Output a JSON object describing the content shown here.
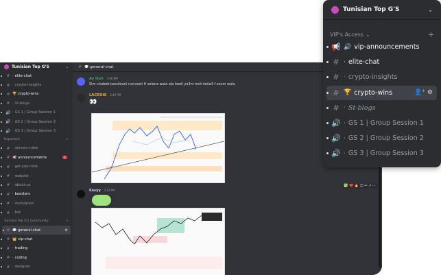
{
  "server": {
    "name": "Tunisian Top G'S"
  },
  "sidebar": {
    "channels_top": [
      {
        "icon": "#",
        "emoji": "·",
        "label": "elite-chat",
        "bright": true
      },
      {
        "icon": "#",
        "emoji": "·",
        "label": "crypto-insights"
      },
      {
        "icon": "#",
        "emoji": "🏆",
        "label": "crypto-wins",
        "bright": true
      },
      {
        "icon": "#",
        "emoji": "·",
        "label": "St-blogs",
        "italic": true
      },
      {
        "icon": "🔊",
        "emoji": "·",
        "label": "GS 1 | Group Session 1"
      },
      {
        "icon": "🔊",
        "emoji": "·",
        "label": "GS 2 | Group Session 2"
      },
      {
        "icon": "🔊",
        "emoji": "·",
        "label": "GS 3 | Group Session 3"
      }
    ],
    "category_important": "Important",
    "channels_important": [
      {
        "icon": "#",
        "emoji": "·",
        "label": "servers-rules"
      },
      {
        "icon": "#",
        "emoji": "📢",
        "label": "announcements",
        "bright": true,
        "badge": "1"
      },
      {
        "icon": "#",
        "emoji": "·",
        "label": "get-your-role"
      },
      {
        "icon": "#",
        "emoji": "·",
        "label": "website"
      },
      {
        "icon": "#",
        "emoji": "·",
        "label": "about-us"
      },
      {
        "icon": "#",
        "emoji": "·",
        "label": "boosters",
        "bright": true
      },
      {
        "icon": "#",
        "emoji": "·",
        "label": "motivation"
      },
      {
        "icon": "#",
        "emoji": "·",
        "label": "bot"
      }
    ],
    "category_community": "Tunisian Top G's Community",
    "channels_community": [
      {
        "icon": "#",
        "emoji": "💬",
        "label": "general-chat",
        "active": true
      },
      {
        "icon": "#",
        "emoji": "👑",
        "label": "vip-chat",
        "bright": true
      },
      {
        "icon": "#",
        "emoji": "·",
        "label": "trading",
        "bright": true
      },
      {
        "icon": "#",
        "emoji": "·",
        "label": "coding",
        "bright": true
      },
      {
        "icon": "#",
        "emoji": "·",
        "label": "designer"
      }
    ]
  },
  "main": {
    "channel_name": "general-chat",
    "messages": [
      {
        "user": "Ay Ouh",
        "user_color": "#3ba55c",
        "time": "3:46 PM",
        "text": "Slm chabeb tansilouni nanvesti fi solana wala ala tweli ya3ni mch tetla3 f soum wala"
      },
      {
        "user": "LACROIX",
        "user_color": "#f0b232",
        "time": "3:49 PM",
        "text": "👀"
      },
      {
        "user": "Easyy",
        "user_color": "#c9cdfb",
        "time": "3:52 PM",
        "text": ""
      }
    ],
    "reactions": "✅ ❤️ 🔥  ☺ ↩ ↗ ⋯"
  },
  "popup": {
    "server_name": "Tunisian Top G'S",
    "category": "VIP's Access",
    "channels": [
      {
        "icon": "📢",
        "emoji": "🔊",
        "label": "vip-announcements",
        "bright": true
      },
      {
        "icon": "#",
        "emoji": "·",
        "label": "elite-chat",
        "bright": true
      },
      {
        "icon": "#",
        "emoji": "·",
        "label": "crypto-insights"
      },
      {
        "icon": "#",
        "emoji": "🏆",
        "label": "crypto-wins",
        "active": true
      },
      {
        "icon": "#",
        "emoji": "·",
        "label": "St-blogs",
        "italic": true
      },
      {
        "icon": "🔊",
        "emoji": "·",
        "label": "GS 1 | Group Session 1"
      },
      {
        "icon": "🔊",
        "emoji": "·",
        "label": "GS 2 | Group Session 2"
      },
      {
        "icon": "🔊",
        "emoji": "·",
        "label": "GS 3 | Group Session 3"
      }
    ]
  }
}
